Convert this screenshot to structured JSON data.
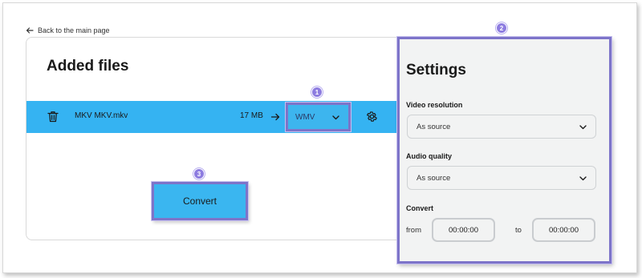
{
  "nav": {
    "back_label": "Back to the main page"
  },
  "files": {
    "title": "Added files",
    "rows": [
      {
        "name": "MKV MKV.mkv",
        "size": "17 MB",
        "format": "WMV"
      }
    ]
  },
  "actions": {
    "convert_label": "Convert"
  },
  "settings": {
    "title": "Settings",
    "video_resolution": {
      "label": "Video resolution",
      "value": "As source"
    },
    "audio_quality": {
      "label": "Audio quality",
      "value": "As source"
    },
    "convert_range": {
      "label": "Convert",
      "from_label": "from",
      "from_value": "00:00:00",
      "to_label": "to",
      "to_value": "00:00:00"
    }
  },
  "annotations": {
    "badge_1": "1",
    "badge_2": "2",
    "badge_3": "3"
  },
  "colors": {
    "accent_blue": "#35b3f2",
    "highlight_purple": "#7d74c9",
    "badge_purple": "#8d7ce0",
    "panel_gray": "#f2f3f3"
  },
  "icons": [
    "arrow-left-icon",
    "trash-icon",
    "arrow-right-icon",
    "chevron-down-icon",
    "gear-icon"
  ]
}
